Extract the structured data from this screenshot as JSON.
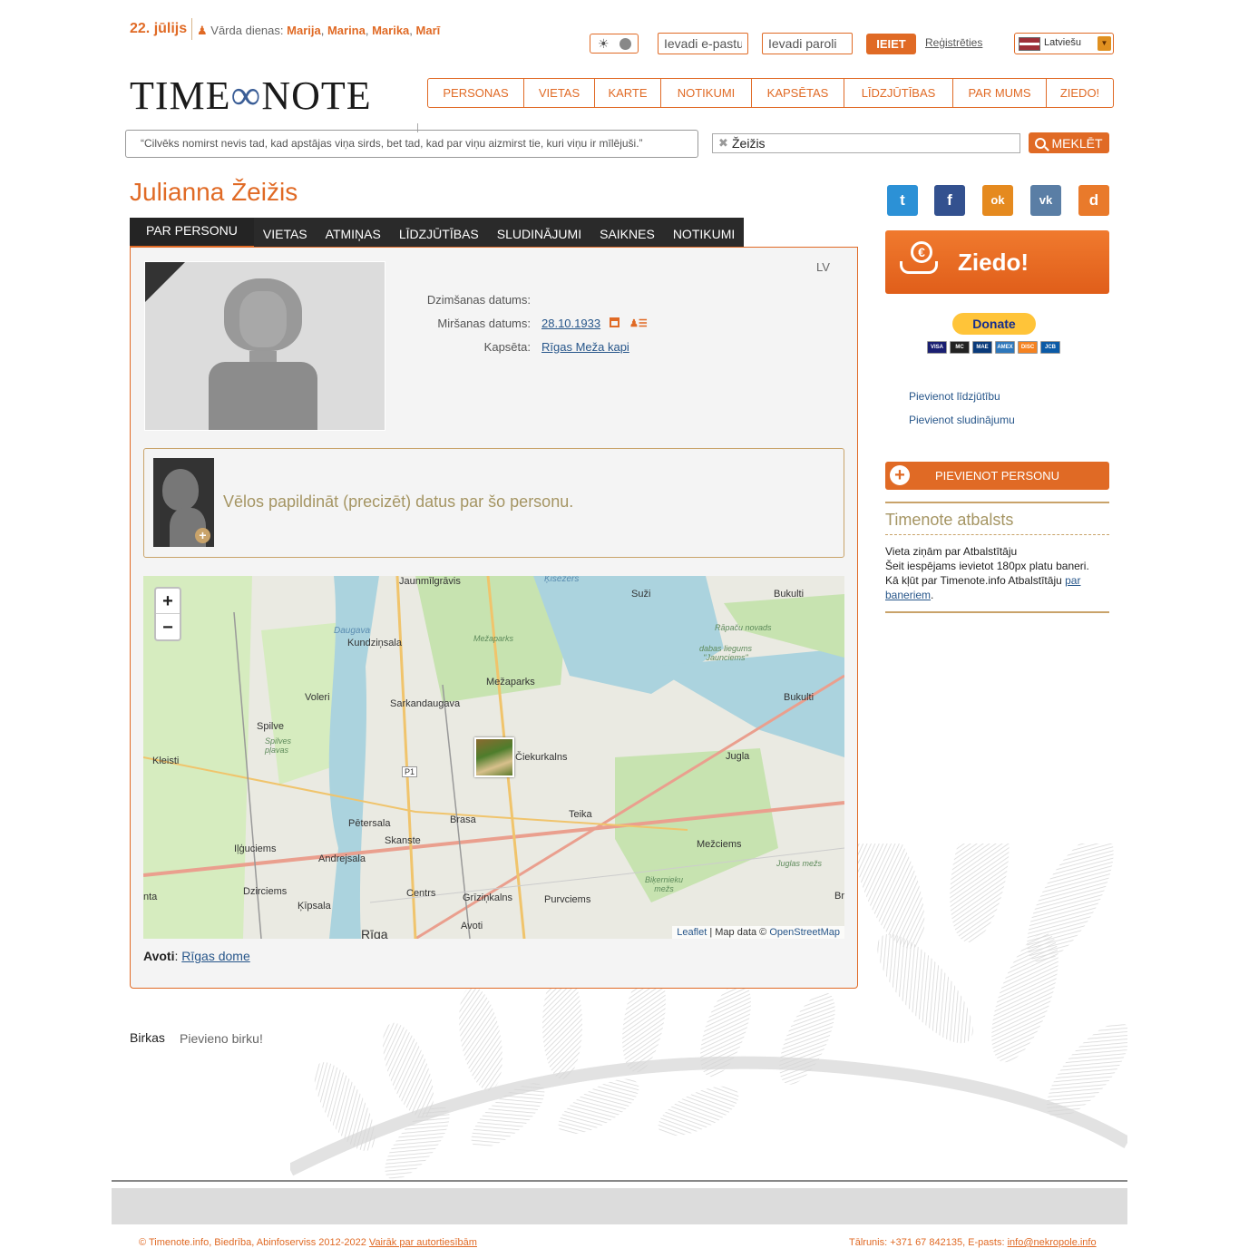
{
  "topbar": {
    "date": "22. jūlijs",
    "namedays_label": "Vārda dienas:",
    "namedays": [
      "Marija",
      "Marina",
      "Marika",
      "Marī"
    ],
    "email_placeholder": "Ievadi e-pastu",
    "password_placeholder": "Ievadi paroli",
    "login_label": "IEIET",
    "register_label": "Reģistrēties",
    "language": "Latviešu"
  },
  "logo": {
    "left": "TIME",
    "right": "NOTE"
  },
  "nav": [
    "PERSONAS",
    "VIETAS",
    "KARTE",
    "NOTIKUMI",
    "KAPSĒTAS",
    "LĪDZJŪTĪBAS",
    "PAR MUMS",
    "ZIEDO!"
  ],
  "quote": "“Cilvēks nomirst nevis tad, kad apstājas viņa sirds, bet tad, kad par viņu aizmirst tie, kuri viņu ir mīlējuši.”",
  "search": {
    "value": "Žeižis",
    "button_label": "MEKLĒT"
  },
  "person": {
    "name": "Julianna Žeižis",
    "lang": "LV",
    "birth_label": "Dzimšanas datums:",
    "birth_value": "",
    "death_label": "Miršanas datums:",
    "death_value": "28.10.1933",
    "cemetery_label": "Kapsēta:",
    "cemetery_value": "Rīgas Meža kapi",
    "suggest_text": "Vēlos papildināt (precizēt) datus par šo personu.",
    "sources_label": "Avoti",
    "sources_value": "Rīgas dome"
  },
  "tabs": [
    "PAR PERSONU",
    "VIETAS",
    "ATMIŅAS",
    "LĪDZJŪTĪBAS",
    "SLUDINĀJUMI",
    "SAIKNES",
    "NOTIKUMI"
  ],
  "map": {
    "zoom_in": "+",
    "zoom_out": "−",
    "attribution_leaflet": "Leaflet",
    "attribution_sep": " | Map data © ",
    "attribution_osm": "OpenStreetMap",
    "labels": [
      "Jaunmīlgrāvis",
      "Ķīšezers",
      "Suži",
      "Bukulti",
      "Daugava",
      "Kundziņsala",
      "Mežaparks",
      "Rāpaču novads",
      "dabas liegums \"Jaunciems\"",
      "Mežaparks",
      "Voleri",
      "Sarkandaugava",
      "Bukulti",
      "Spilve",
      "Spilves pļavas",
      "Kleisti",
      "Čiekurkalns",
      "Jugla",
      "P1",
      "Brasa",
      "Teika",
      "Pētersala",
      "Skanste",
      "Iļģuciems",
      "Andrejsala",
      "Mežciems",
      "Juglas mežs",
      "Biķernieku mežs",
      "Dzirciems",
      "Centrs",
      "Grīziņkalns",
      "Purvciems",
      "Ķīpsala",
      "Avoti",
      "Rīga",
      "nta",
      "Br"
    ]
  },
  "sidebar": {
    "donate_label": "Ziedo!",
    "paypal_label": "Donate",
    "cards": [
      "VISA",
      "MC",
      "MAE",
      "AMEX",
      "DISC",
      "JCB"
    ],
    "link_condolence": "Pievienot līdzjūtību",
    "link_ad": "Pievienot sludinājumu",
    "add_person_label": "PIEVIENOT PERSONU",
    "support_title": "Timenote atbalsts",
    "support_line1": "Vieta ziņām par Atbalstītāju",
    "support_line2": "Šeit iespējams ievietot 180px platu baneri.",
    "support_line3_prefix": "Kā kļūt par Timenote.info Atbalstītāju ",
    "support_line3_link": "par baneriem",
    "support_line3_suffix": "."
  },
  "tags": {
    "label": "Birkas",
    "add": "Pievieno birku!"
  },
  "footer": {
    "left_text": "© Timenote.info, Biedrība, Abinfoserviss 2012-2022 ",
    "left_link": "Vairāk par autortiesībām",
    "right_text": "Tālrunis: +371 67 842135, E-pasts: ",
    "right_link": "info@nekropole.info"
  },
  "colors": {
    "accent": "#e06a25",
    "gold": "#c9a36a",
    "link": "#27568a"
  },
  "social": [
    {
      "name": "twitter",
      "color": "#2c91d6",
      "glyph": "t"
    },
    {
      "name": "facebook",
      "color": "#33518f",
      "glyph": "f"
    },
    {
      "name": "odnoklassniki",
      "color": "#e58a1f",
      "glyph": "ok"
    },
    {
      "name": "vkontakte",
      "color": "#5a7ea5",
      "glyph": "vk"
    },
    {
      "name": "draugiem",
      "color": "#e97a2b",
      "glyph": "d"
    }
  ]
}
